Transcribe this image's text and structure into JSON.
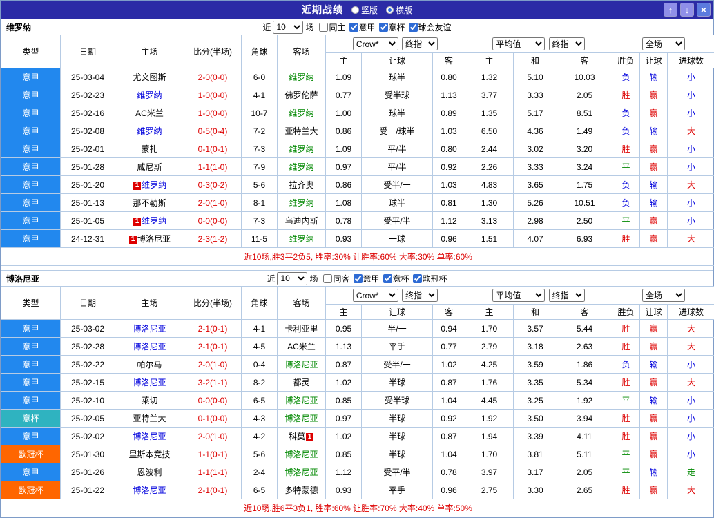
{
  "titlebar": {
    "title": "近期战绩",
    "radios": [
      {
        "label": "竖版",
        "selected": false
      },
      {
        "label": "横版",
        "selected": true
      }
    ],
    "buttons": {
      "up": "↑",
      "down": "↓",
      "close": "×"
    }
  },
  "colors": {
    "type": {
      "意甲": "#2288EE",
      "意杯": "#2FB3C0",
      "欧冠杯": "#FF6600"
    },
    "team": {
      "home_focus": "#0000DD",
      "away_focus": "#008800",
      "plain": "#000000"
    },
    "result": {
      "胜": "#DD0000",
      "赢": "#DD0000",
      "大": "#DD0000",
      "平": "#008800",
      "走": "#008800",
      "负": "#0000DD",
      "输": "#0000DD",
      "小": "#0000DD"
    },
    "score": "#DD0000"
  },
  "sections": [
    {
      "team": "维罗纳",
      "filter": {
        "near": "近",
        "count": "10",
        "unit": "场",
        "checkboxes": [
          {
            "label": "同主",
            "checked": false
          },
          {
            "label": "意甲",
            "checked": true
          },
          {
            "label": "意杯",
            "checked": true
          },
          {
            "label": "球会友谊",
            "checked": true
          }
        ]
      },
      "selects": {
        "company": "Crow*",
        "company_time": "终指",
        "avg": "平均值",
        "avg_time": "终指",
        "scope": "全场"
      },
      "columns": [
        "类型",
        "日期",
        "主场",
        "比分(半场)",
        "角球",
        "客场",
        "主",
        "让球",
        "客",
        "主",
        "和",
        "客",
        "胜负",
        "让球",
        "进球数"
      ],
      "rows": [
        {
          "type": "意甲",
          "date": "25-03-04",
          "home": {
            "name": "尤文图斯",
            "style": "plain",
            "card": null
          },
          "score": "2-0(0-0)",
          "corners": "6-0",
          "away": {
            "name": "维罗纳",
            "style": "away_focus",
            "card": null
          },
          "handicap": [
            "1.09",
            "球半",
            "0.80"
          ],
          "europe": [
            "1.32",
            "5.10",
            "10.03"
          ],
          "results": [
            "负",
            "输",
            "小"
          ]
        },
        {
          "type": "意甲",
          "date": "25-02-23",
          "home": {
            "name": "维罗纳",
            "style": "home_focus",
            "card": null
          },
          "score": "1-0(0-0)",
          "corners": "4-1",
          "away": {
            "name": "佛罗伦萨",
            "style": "plain",
            "card": null
          },
          "handicap": [
            "0.77",
            "受半球",
            "1.13"
          ],
          "europe": [
            "3.77",
            "3.33",
            "2.05"
          ],
          "results": [
            "胜",
            "赢",
            "小"
          ]
        },
        {
          "type": "意甲",
          "date": "25-02-16",
          "home": {
            "name": "AC米兰",
            "style": "plain",
            "card": null
          },
          "score": "1-0(0-0)",
          "corners": "10-7",
          "away": {
            "name": "维罗纳",
            "style": "away_focus",
            "card": null
          },
          "handicap": [
            "1.00",
            "球半",
            "0.89"
          ],
          "europe": [
            "1.35",
            "5.17",
            "8.51"
          ],
          "results": [
            "负",
            "赢",
            "小"
          ]
        },
        {
          "type": "意甲",
          "date": "25-02-08",
          "home": {
            "name": "维罗纳",
            "style": "home_focus",
            "card": null
          },
          "score": "0-5(0-4)",
          "corners": "7-2",
          "away": {
            "name": "亚特兰大",
            "style": "plain",
            "card": null
          },
          "handicap": [
            "0.86",
            "受一/球半",
            "1.03"
          ],
          "europe": [
            "6.50",
            "4.36",
            "1.49"
          ],
          "results": [
            "负",
            "输",
            "大"
          ]
        },
        {
          "type": "意甲",
          "date": "25-02-01",
          "home": {
            "name": "蒙扎",
            "style": "plain",
            "card": null
          },
          "score": "0-1(0-1)",
          "corners": "7-3",
          "away": {
            "name": "维罗纳",
            "style": "away_focus",
            "card": null
          },
          "handicap": [
            "1.09",
            "平/半",
            "0.80"
          ],
          "europe": [
            "2.44",
            "3.02",
            "3.20"
          ],
          "results": [
            "胜",
            "赢",
            "小"
          ]
        },
        {
          "type": "意甲",
          "date": "25-01-28",
          "home": {
            "name": "威尼斯",
            "style": "plain",
            "card": null
          },
          "score": "1-1(1-0)",
          "corners": "7-9",
          "away": {
            "name": "维罗纳",
            "style": "away_focus",
            "card": null
          },
          "handicap": [
            "0.97",
            "平/半",
            "0.92"
          ],
          "europe": [
            "2.26",
            "3.33",
            "3.24"
          ],
          "results": [
            "平",
            "赢",
            "小"
          ]
        },
        {
          "type": "意甲",
          "date": "25-01-20",
          "home": {
            "name": "维罗纳",
            "style": "home_focus",
            "card": "before"
          },
          "score": "0-3(0-2)",
          "corners": "5-6",
          "away": {
            "name": "拉齐奥",
            "style": "plain",
            "card": null
          },
          "handicap": [
            "0.86",
            "受半/一",
            "1.03"
          ],
          "europe": [
            "4.83",
            "3.65",
            "1.75"
          ],
          "results": [
            "负",
            "输",
            "大"
          ]
        },
        {
          "type": "意甲",
          "date": "25-01-13",
          "home": {
            "name": "那不勒斯",
            "style": "plain",
            "card": null
          },
          "score": "2-0(1-0)",
          "corners": "8-1",
          "away": {
            "name": "维罗纳",
            "style": "away_focus",
            "card": null
          },
          "handicap": [
            "1.08",
            "球半",
            "0.81"
          ],
          "europe": [
            "1.30",
            "5.26",
            "10.51"
          ],
          "results": [
            "负",
            "输",
            "小"
          ]
        },
        {
          "type": "意甲",
          "date": "25-01-05",
          "home": {
            "name": "维罗纳",
            "style": "home_focus",
            "card": "before"
          },
          "score": "0-0(0-0)",
          "corners": "7-3",
          "away": {
            "name": "乌迪内斯",
            "style": "plain",
            "card": null
          },
          "handicap": [
            "0.78",
            "受平/半",
            "1.12"
          ],
          "europe": [
            "3.13",
            "2.98",
            "2.50"
          ],
          "results": [
            "平",
            "赢",
            "小"
          ]
        },
        {
          "type": "意甲",
          "date": "24-12-31",
          "home": {
            "name": "博洛尼亚",
            "style": "plain",
            "card": "before"
          },
          "score": "2-3(1-2)",
          "corners": "11-5",
          "away": {
            "name": "维罗纳",
            "style": "away_focus",
            "card": null
          },
          "handicap": [
            "0.93",
            "一球",
            "0.96"
          ],
          "europe": [
            "1.51",
            "4.07",
            "6.93"
          ],
          "results": [
            "胜",
            "赢",
            "大"
          ]
        }
      ],
      "summary": "近10场,胜3平2负5, 胜率:30% 让胜率:60% 大率:30% 单率:60%"
    },
    {
      "team": "博洛尼亚",
      "filter": {
        "near": "近",
        "count": "10",
        "unit": "场",
        "checkboxes": [
          {
            "label": "同客",
            "checked": false
          },
          {
            "label": "意甲",
            "checked": true
          },
          {
            "label": "意杯",
            "checked": true
          },
          {
            "label": "欧冠杯",
            "checked": true
          }
        ]
      },
      "selects": {
        "company": "Crow*",
        "company_time": "终指",
        "avg": "平均值",
        "avg_time": "终指",
        "scope": "全场"
      },
      "columns": [
        "类型",
        "日期",
        "主场",
        "比分(半场)",
        "角球",
        "客场",
        "主",
        "让球",
        "客",
        "主",
        "和",
        "客",
        "胜负",
        "让球",
        "进球数"
      ],
      "rows": [
        {
          "type": "意甲",
          "date": "25-03-02",
          "home": {
            "name": "博洛尼亚",
            "style": "home_focus",
            "card": null
          },
          "score": "2-1(0-1)",
          "corners": "4-1",
          "away": {
            "name": "卡利亚里",
            "style": "plain",
            "card": null
          },
          "handicap": [
            "0.95",
            "半/一",
            "0.94"
          ],
          "europe": [
            "1.70",
            "3.57",
            "5.44"
          ],
          "results": [
            "胜",
            "赢",
            "大"
          ]
        },
        {
          "type": "意甲",
          "date": "25-02-28",
          "home": {
            "name": "博洛尼亚",
            "style": "home_focus",
            "card": null
          },
          "score": "2-1(0-1)",
          "corners": "4-5",
          "away": {
            "name": "AC米兰",
            "style": "plain",
            "card": null
          },
          "handicap": [
            "1.13",
            "平手",
            "0.77"
          ],
          "europe": [
            "2.79",
            "3.18",
            "2.63"
          ],
          "results": [
            "胜",
            "赢",
            "大"
          ]
        },
        {
          "type": "意甲",
          "date": "25-02-22",
          "home": {
            "name": "帕尔马",
            "style": "plain",
            "card": null
          },
          "score": "2-0(1-0)",
          "corners": "0-4",
          "away": {
            "name": "博洛尼亚",
            "style": "away_focus",
            "card": null
          },
          "handicap": [
            "0.87",
            "受半/一",
            "1.02"
          ],
          "europe": [
            "4.25",
            "3.59",
            "1.86"
          ],
          "results": [
            "负",
            "输",
            "小"
          ]
        },
        {
          "type": "意甲",
          "date": "25-02-15",
          "home": {
            "name": "博洛尼亚",
            "style": "home_focus",
            "card": null
          },
          "score": "3-2(1-1)",
          "corners": "8-2",
          "away": {
            "name": "都灵",
            "style": "plain",
            "card": null
          },
          "handicap": [
            "1.02",
            "半球",
            "0.87"
          ],
          "europe": [
            "1.76",
            "3.35",
            "5.34"
          ],
          "results": [
            "胜",
            "赢",
            "大"
          ]
        },
        {
          "type": "意甲",
          "date": "25-02-10",
          "home": {
            "name": "莱切",
            "style": "plain",
            "card": null
          },
          "score": "0-0(0-0)",
          "corners": "6-5",
          "away": {
            "name": "博洛尼亚",
            "style": "away_focus",
            "card": null
          },
          "handicap": [
            "0.85",
            "受半球",
            "1.04"
          ],
          "europe": [
            "4.45",
            "3.25",
            "1.92"
          ],
          "results": [
            "平",
            "输",
            "小"
          ]
        },
        {
          "type": "意杯",
          "date": "25-02-05",
          "home": {
            "name": "亚特兰大",
            "style": "plain",
            "card": null
          },
          "score": "0-1(0-0)",
          "corners": "4-3",
          "away": {
            "name": "博洛尼亚",
            "style": "away_focus",
            "card": null
          },
          "handicap": [
            "0.97",
            "半球",
            "0.92"
          ],
          "europe": [
            "1.92",
            "3.50",
            "3.94"
          ],
          "results": [
            "胜",
            "赢",
            "小"
          ]
        },
        {
          "type": "意甲",
          "date": "25-02-02",
          "home": {
            "name": "博洛尼亚",
            "style": "home_focus",
            "card": null
          },
          "score": "2-0(1-0)",
          "corners": "4-2",
          "away": {
            "name": "科莫",
            "style": "plain",
            "card": "after"
          },
          "handicap": [
            "1.02",
            "半球",
            "0.87"
          ],
          "europe": [
            "1.94",
            "3.39",
            "4.11"
          ],
          "results": [
            "胜",
            "赢",
            "小"
          ]
        },
        {
          "type": "欧冠杯",
          "date": "25-01-30",
          "home": {
            "name": "里斯本竞技",
            "style": "plain",
            "card": null
          },
          "score": "1-1(0-1)",
          "corners": "5-6",
          "away": {
            "name": "博洛尼亚",
            "style": "away_focus",
            "card": null
          },
          "handicap": [
            "0.85",
            "半球",
            "1.04"
          ],
          "europe": [
            "1.70",
            "3.81",
            "5.11"
          ],
          "results": [
            "平",
            "赢",
            "小"
          ]
        },
        {
          "type": "意甲",
          "date": "25-01-26",
          "home": {
            "name": "恩波利",
            "style": "plain",
            "card": null
          },
          "score": "1-1(1-1)",
          "corners": "2-4",
          "away": {
            "name": "博洛尼亚",
            "style": "away_focus",
            "card": null
          },
          "handicap": [
            "1.12",
            "受平/半",
            "0.78"
          ],
          "europe": [
            "3.97",
            "3.17",
            "2.05"
          ],
          "results": [
            "平",
            "输",
            "走"
          ]
        },
        {
          "type": "欧冠杯",
          "date": "25-01-22",
          "home": {
            "name": "博洛尼亚",
            "style": "home_focus",
            "card": null
          },
          "score": "2-1(0-1)",
          "corners": "6-5",
          "away": {
            "name": "多特蒙德",
            "style": "plain",
            "card": null
          },
          "handicap": [
            "0.93",
            "平手",
            "0.96"
          ],
          "europe": [
            "2.75",
            "3.30",
            "2.65"
          ],
          "results": [
            "胜",
            "赢",
            "大"
          ]
        }
      ],
      "summary": "近10场,胜6平3负1, 胜率:60% 让胜率:70% 大率:40% 单率:50%"
    }
  ]
}
